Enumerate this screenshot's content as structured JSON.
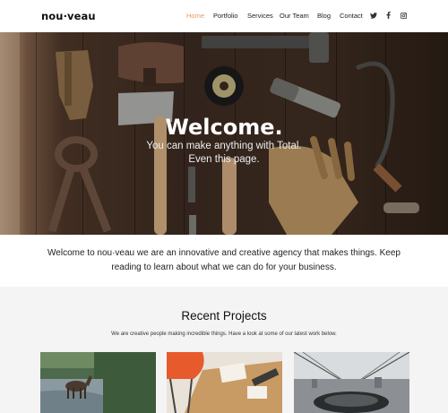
{
  "header": {
    "logo": "nou·veau",
    "nav": [
      "Home",
      "Portfolio",
      "Services",
      "Our Team",
      "Blog",
      "Contact"
    ],
    "active": "Home",
    "social_icons": [
      "twitter-icon",
      "facebook-icon",
      "instagram-icon"
    ],
    "accent_color": "#e59a63"
  },
  "hero": {
    "title": "Welcome.",
    "subtitle_line1": "You can make anything with Total.",
    "subtitle_line2": "Even this page."
  },
  "intro": {
    "text": "Welcome to nou·veau we are an innovative and creative agency that makes things. Keep reading to learn about what we can do for your business."
  },
  "projects": {
    "title": "Recent Projects",
    "subtitle": "We are creative people making incredible things. Have a look at some of our latest work below."
  }
}
